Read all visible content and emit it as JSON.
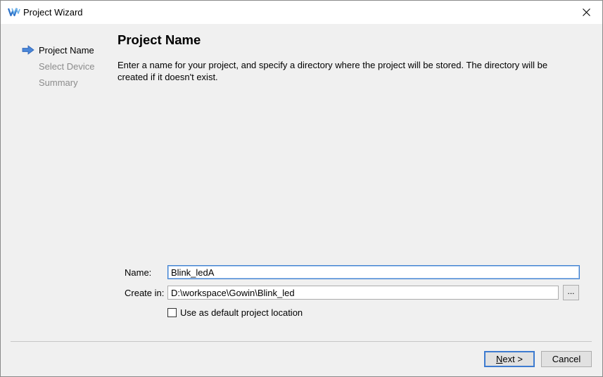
{
  "window": {
    "title": "Project Wizard",
    "icon": "gowin-logo-icon",
    "close_icon": "close-icon"
  },
  "steps": [
    {
      "label": "Project Name",
      "state": "active"
    },
    {
      "label": "Select Device",
      "state": "inactive"
    },
    {
      "label": "Summary",
      "state": "inactive"
    }
  ],
  "page": {
    "title": "Project Name",
    "description": "Enter a name for your project, and specify a directory where the project will be stored. The directory will be created if it doesn't exist."
  },
  "form": {
    "name_label": "Name:",
    "name_value": "Blink_ledA",
    "create_in_label": "Create in:",
    "create_in_value": "D:\\workspace\\Gowin\\Blink_led",
    "browse_label": "...",
    "default_location_label": "Use as default project location",
    "default_location_checked": false
  },
  "buttons": {
    "next_mnemonic": "N",
    "next_rest": "ext >",
    "cancel": "Cancel"
  },
  "colors": {
    "accent": "#3d7bd0",
    "arrow": "#4a86d8",
    "dialog_bg": "#f0f0f0"
  }
}
